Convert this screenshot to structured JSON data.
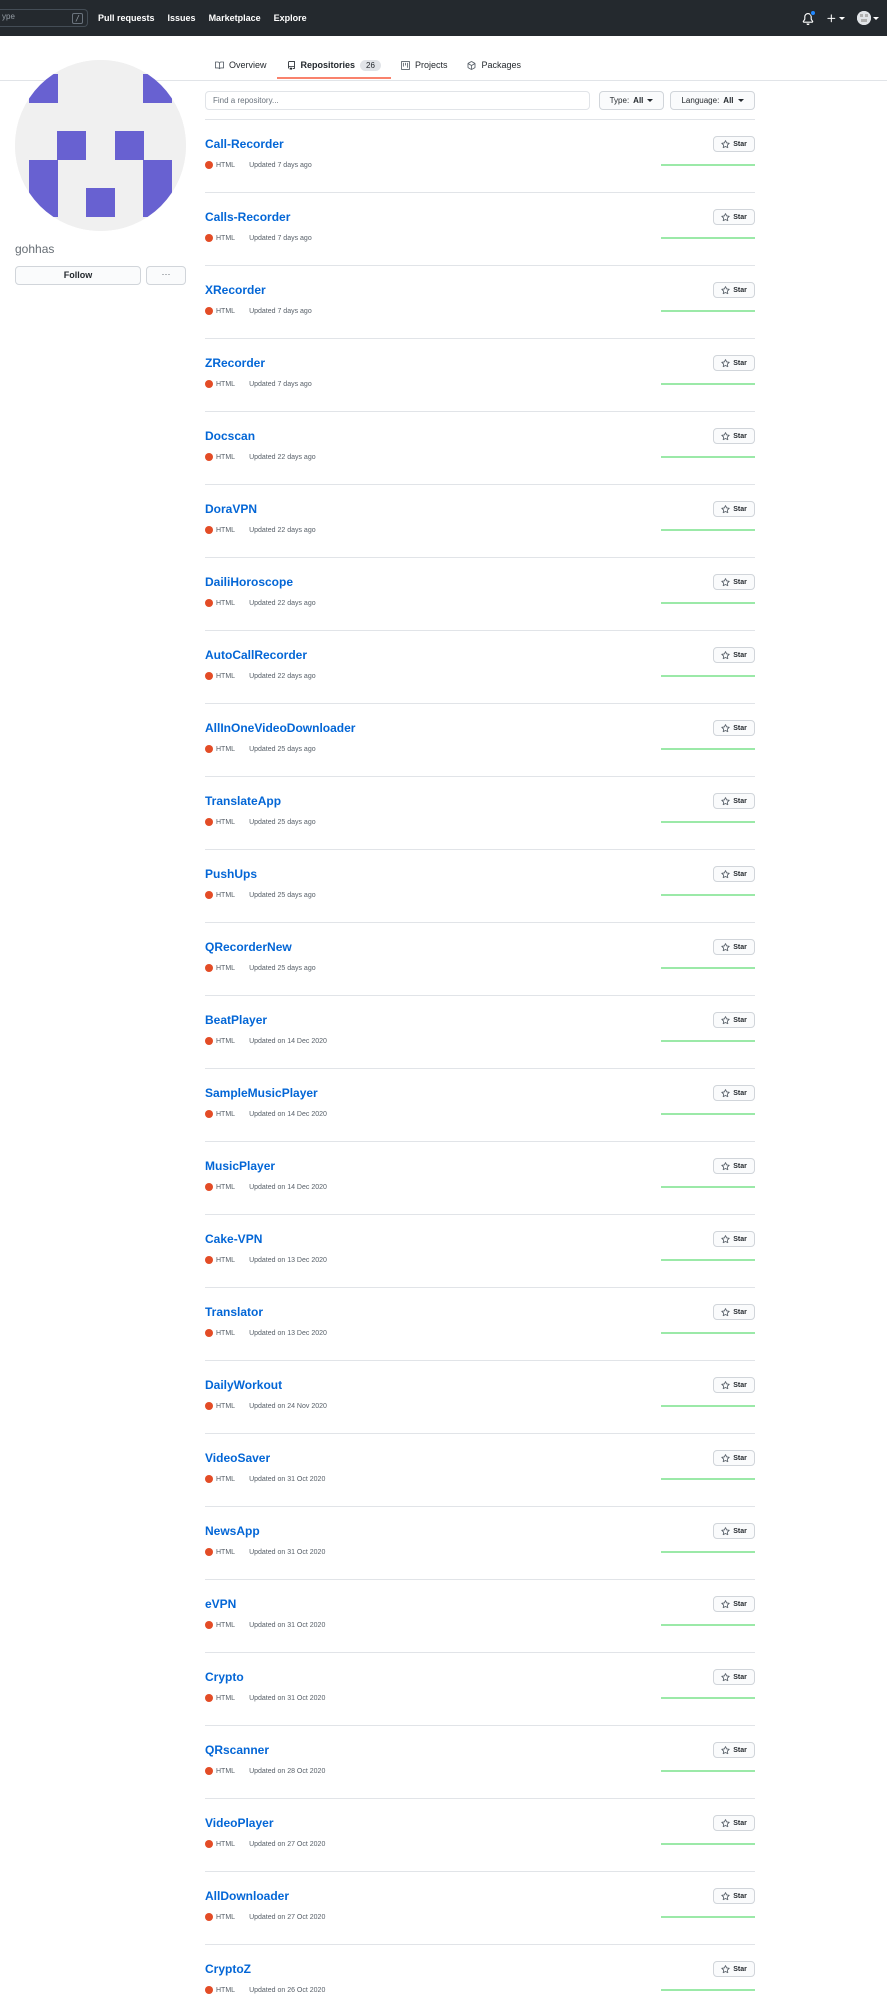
{
  "header": {
    "search_typed": "ype",
    "search_key": "/",
    "nav": [
      "Pull requests",
      "Issues",
      "Marketplace",
      "Explore"
    ]
  },
  "tabs": [
    {
      "label": "Overview",
      "icon": "book-icon"
    },
    {
      "label": "Repositories",
      "icon": "repo-icon",
      "count": "26",
      "active": true
    },
    {
      "label": "Projects",
      "icon": "project-icon"
    },
    {
      "label": "Packages",
      "icon": "package-icon"
    }
  ],
  "profile": {
    "username": "gohhas",
    "follow_label": "Follow",
    "more_label": "···",
    "avatar_color": "#6861d1"
  },
  "filters": {
    "search_placeholder": "Find a repository...",
    "type_label": "Type:",
    "type_value": "All",
    "language_label": "Language:",
    "language_value": "All"
  },
  "star_label": "Star",
  "language_color": "#e34c26",
  "repos": [
    {
      "name": "Call-Recorder",
      "language": "HTML",
      "updated": "Updated 7 days ago"
    },
    {
      "name": "Calls-Recorder",
      "language": "HTML",
      "updated": "Updated 7 days ago"
    },
    {
      "name": "XRecorder",
      "language": "HTML",
      "updated": "Updated 7 days ago"
    },
    {
      "name": "ZRecorder",
      "language": "HTML",
      "updated": "Updated 7 days ago"
    },
    {
      "name": "Docscan",
      "language": "HTML",
      "updated": "Updated 22 days ago"
    },
    {
      "name": "DoraVPN",
      "language": "HTML",
      "updated": "Updated 22 days ago"
    },
    {
      "name": "DailiHoroscope",
      "language": "HTML",
      "updated": "Updated 22 days ago"
    },
    {
      "name": "AutoCallRecorder",
      "language": "HTML",
      "updated": "Updated 22 days ago"
    },
    {
      "name": "AllInOneVideoDownloader",
      "language": "HTML",
      "updated": "Updated 25 days ago"
    },
    {
      "name": "TranslateApp",
      "language": "HTML",
      "updated": "Updated 25 days ago"
    },
    {
      "name": "PushUps",
      "language": "HTML",
      "updated": "Updated 25 days ago"
    },
    {
      "name": "QRecorderNew",
      "language": "HTML",
      "updated": "Updated 25 days ago"
    },
    {
      "name": "BeatPlayer",
      "language": "HTML",
      "updated": "Updated on 14 Dec 2020"
    },
    {
      "name": "SampleMusicPlayer",
      "language": "HTML",
      "updated": "Updated on 14 Dec 2020"
    },
    {
      "name": "MusicPlayer",
      "language": "HTML",
      "updated": "Updated on 14 Dec 2020"
    },
    {
      "name": "Cake-VPN",
      "language": "HTML",
      "updated": "Updated on 13 Dec 2020"
    },
    {
      "name": "Translator",
      "language": "HTML",
      "updated": "Updated on 13 Dec 2020"
    },
    {
      "name": "DailyWorkout",
      "language": "HTML",
      "updated": "Updated on 24 Nov 2020"
    },
    {
      "name": "VideoSaver",
      "language": "HTML",
      "updated": "Updated on 31 Oct 2020"
    },
    {
      "name": "NewsApp",
      "language": "HTML",
      "updated": "Updated on 31 Oct 2020"
    },
    {
      "name": "eVPN",
      "language": "HTML",
      "updated": "Updated on 31 Oct 2020"
    },
    {
      "name": "Crypto",
      "language": "HTML",
      "updated": "Updated on 31 Oct 2020"
    },
    {
      "name": "QRscanner",
      "language": "HTML",
      "updated": "Updated on 28 Oct 2020"
    },
    {
      "name": "VideoPlayer",
      "language": "HTML",
      "updated": "Updated on 27 Oct 2020"
    },
    {
      "name": "AllDownloader",
      "language": "HTML",
      "updated": "Updated on 27 Oct 2020"
    },
    {
      "name": "CryptoZ",
      "language": "HTML",
      "updated": "Updated on 26 Oct 2020"
    }
  ]
}
